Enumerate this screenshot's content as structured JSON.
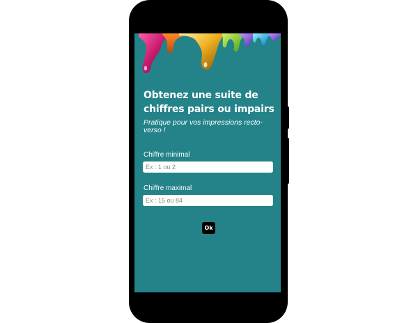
{
  "form": {
    "title": "Obtenez une suite de chiffres pairs ou impairs",
    "subtitle": "Pratique pour vos impressions recto-verso !",
    "min_label": "Chiffre minimal",
    "min_placeholder": "Ex : 1 ou 2",
    "min_value": "",
    "max_label": "Chiffre maximal",
    "max_placeholder": "Ex : 15 ou 84",
    "max_value": "",
    "ok_label": "Ok"
  },
  "colors": {
    "screen_background": "#238389",
    "button_background": "#000000",
    "text": "#ffffff"
  },
  "icons": {
    "header_art": "paint-drips-image"
  }
}
